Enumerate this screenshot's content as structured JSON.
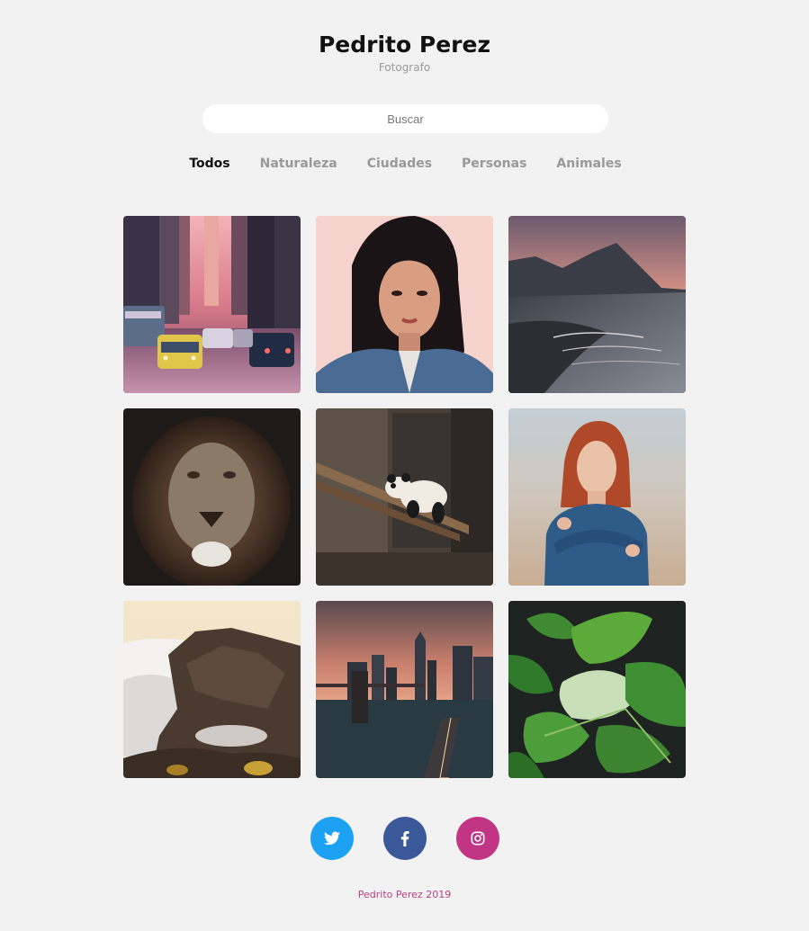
{
  "header": {
    "title": "Pedrito Perez",
    "subtitle": "Fotografo"
  },
  "search": {
    "placeholder": "Buscar"
  },
  "filters": [
    {
      "label": "Todos",
      "active": true
    },
    {
      "label": "Naturaleza",
      "active": false
    },
    {
      "label": "Ciudades",
      "active": false
    },
    {
      "label": "Personas",
      "active": false
    },
    {
      "label": "Animales",
      "active": false
    }
  ],
  "gallery": [
    {
      "subject": "city-street-traffic",
      "category": "Ciudades"
    },
    {
      "subject": "woman-portrait-pink",
      "category": "Personas"
    },
    {
      "subject": "mountain-beach-sunset",
      "category": "Naturaleza"
    },
    {
      "subject": "lion-face",
      "category": "Animales"
    },
    {
      "subject": "panda-on-branch",
      "category": "Animales"
    },
    {
      "subject": "redhead-woman-portrait",
      "category": "Personas"
    },
    {
      "subject": "cliffs-above-clouds",
      "category": "Naturaleza"
    },
    {
      "subject": "city-skyline-sunset",
      "category": "Ciudades"
    },
    {
      "subject": "green-leaves",
      "category": "Naturaleza"
    }
  ],
  "social": [
    {
      "network": "twitter",
      "icon": "twitter-icon",
      "color": "#1da1f2"
    },
    {
      "network": "facebook",
      "icon": "facebook-icon",
      "color": "#3b5998"
    },
    {
      "network": "instagram",
      "icon": "instagram-icon",
      "color": "#c13584"
    }
  ],
  "footer": {
    "text": "Pedrito Perez 2019"
  },
  "colors": {
    "background": "#f2f2f3",
    "active_filter": "#111111",
    "inactive_filter": "#999999",
    "footer_text": "#b8407e"
  }
}
